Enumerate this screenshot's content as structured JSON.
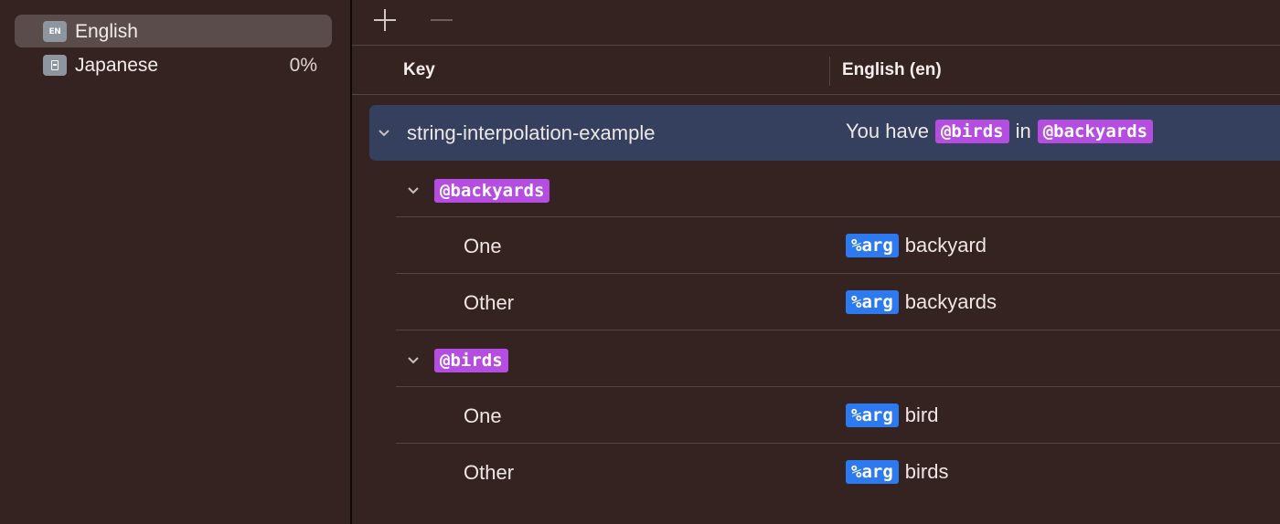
{
  "sidebar": {
    "languages": [
      {
        "code": "EN",
        "label": "English",
        "percent": "",
        "selected": true
      },
      {
        "code": "JA",
        "label": "Japanese",
        "percent": "0%",
        "selected": false
      }
    ]
  },
  "toolbar": {
    "add_icon": "plus-icon",
    "remove_icon": "minus-icon"
  },
  "table": {
    "columns": [
      "Key",
      "English (en)"
    ],
    "main_row": {
      "key": "string-interpolation-example",
      "value": {
        "prefix": "You have",
        "var1": "@birds",
        "mid": "in",
        "var2": "@backyards"
      }
    },
    "groups": [
      {
        "name": "@backyards",
        "rows": [
          {
            "key": "One",
            "arg": "%arg",
            "text": "backyard"
          },
          {
            "key": "Other",
            "arg": "%arg",
            "text": "backyards"
          }
        ]
      },
      {
        "name": "@birds",
        "rows": [
          {
            "key": "One",
            "arg": "%arg",
            "text": "bird"
          },
          {
            "key": "Other",
            "arg": "%arg",
            "text": "birds"
          }
        ]
      }
    ]
  },
  "colors": {
    "background": "#352321",
    "selected_row": "#34405d",
    "variable_token": "#b54de0",
    "arg_token": "#2c79f0"
  }
}
